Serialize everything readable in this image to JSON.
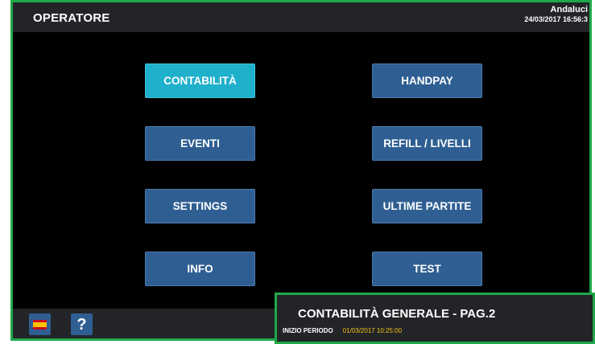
{
  "header": {
    "title": "OPERATORE",
    "user": "Andaluci",
    "datetime": "24/03/2017 16:56:3"
  },
  "menu": {
    "contabilita": "CONTABILITÀ",
    "eventi": "EVENTI",
    "settings": "SETTINGS",
    "info": "INFO",
    "handpay": "HANDPAY",
    "refill": "REFILL / LIVELLI",
    "ultime_partite": "ULTIME PARTITE",
    "test": "TEST",
    "active_item": "CONTABILITÀ"
  },
  "footer": {
    "language_icon": "spain-flag-icon",
    "help_icon": "question-mark-icon",
    "help_glyph": "?"
  },
  "popup": {
    "title": "CONTABILITÀ GENERALE - PAG.2",
    "period_label": "INIZIO PERIODO",
    "period_value": "01/03/2017  10:25:00"
  },
  "colors": {
    "frame_border": "#1fa84a",
    "button": "#2f5f92",
    "button_active": "#1fb0cc",
    "bar": "#232427",
    "period_value": "#f0c419"
  }
}
